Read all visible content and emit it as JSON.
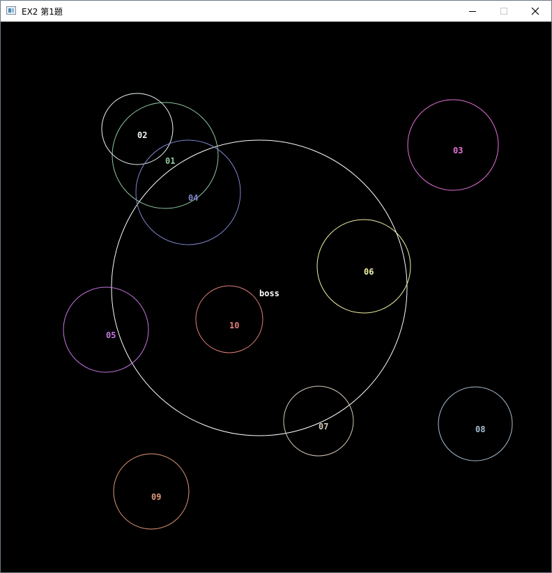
{
  "window": {
    "title": "EX2 第1題"
  },
  "icons": {
    "app": "app-window-icon",
    "minimize": "minimize-icon",
    "maximize": "maximize-icon",
    "close": "close-icon"
  },
  "colors": {
    "background": "#000000",
    "titlebar": "#ffffff"
  },
  "boss": {
    "label": "boss",
    "color": "#ffffff"
  },
  "circles": [
    {
      "id": "01",
      "label": "01",
      "color": "#8fc9a2"
    },
    {
      "id": "02",
      "label": "02",
      "color": "#eef7fa"
    },
    {
      "id": "03",
      "label": "03",
      "color": "#e672d8"
    },
    {
      "id": "04",
      "label": "04",
      "color": "#7f86cc"
    },
    {
      "id": "05",
      "label": "05",
      "color": "#c777e6"
    },
    {
      "id": "06",
      "label": "06",
      "color": "#f3f2a6"
    },
    {
      "id": "07",
      "label": "07",
      "color": "#d8cbb8"
    },
    {
      "id": "08",
      "label": "08",
      "color": "#aabdd0"
    },
    {
      "id": "09",
      "label": "09",
      "color": "#e39a7b"
    },
    {
      "id": "10",
      "label": "10",
      "color": "#e07f7a"
    }
  ]
}
